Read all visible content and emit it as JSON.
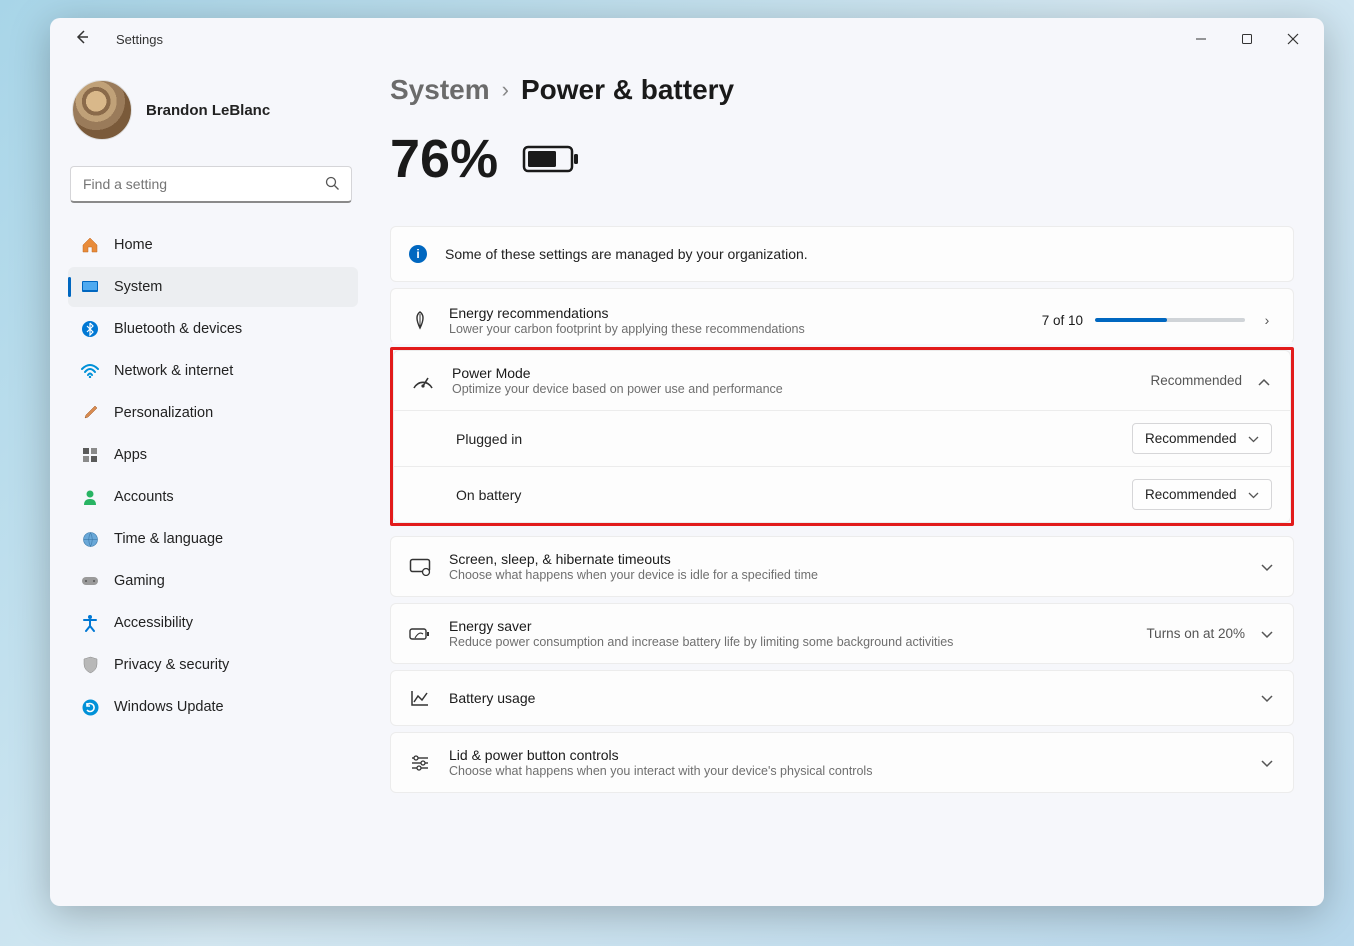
{
  "window": {
    "title": "Settings"
  },
  "profile": {
    "name": "Brandon LeBlanc"
  },
  "search": {
    "placeholder": "Find a setting"
  },
  "sidebar": {
    "items": [
      {
        "label": "Home"
      },
      {
        "label": "System"
      },
      {
        "label": "Bluetooth & devices"
      },
      {
        "label": "Network & internet"
      },
      {
        "label": "Personalization"
      },
      {
        "label": "Apps"
      },
      {
        "label": "Accounts"
      },
      {
        "label": "Time & language"
      },
      {
        "label": "Gaming"
      },
      {
        "label": "Accessibility"
      },
      {
        "label": "Privacy & security"
      },
      {
        "label": "Windows Update"
      }
    ],
    "active_index": 1
  },
  "breadcrumb": {
    "parent": "System",
    "current": "Power & battery"
  },
  "battery": {
    "percent": "76%"
  },
  "info_banner": "Some of these settings are managed by your organization.",
  "panels": {
    "energy_rec": {
      "title": "Energy recommendations",
      "sub": "Lower your carbon footprint by applying these recommendations",
      "progress_label": "7 of 10",
      "progress_pct": 48
    },
    "power_mode": {
      "title": "Power Mode",
      "sub": "Optimize your device based on power use and performance",
      "summary": "Recommended",
      "plugged_label": "Plugged in",
      "plugged_value": "Recommended",
      "battery_label": "On battery",
      "battery_value": "Recommended"
    },
    "screen_sleep": {
      "title": "Screen, sleep, & hibernate timeouts",
      "sub": "Choose what happens when your device is idle for a specified time"
    },
    "energy_saver": {
      "title": "Energy saver",
      "sub": "Reduce power consumption and increase battery life by limiting some background activities",
      "status": "Turns on at 20%"
    },
    "battery_usage": {
      "title": "Battery usage"
    },
    "lid_power": {
      "title": "Lid & power button controls",
      "sub": "Choose what happens when you interact with your device's physical controls"
    }
  }
}
